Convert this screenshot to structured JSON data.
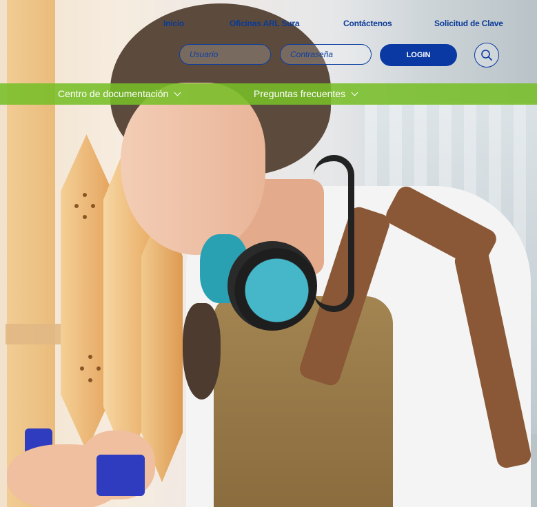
{
  "nav": {
    "items": [
      {
        "label": "Inicio"
      },
      {
        "label": "Oficinas ARL Sura"
      },
      {
        "label": "Contáctenos"
      },
      {
        "label": "Solicitud de Clave"
      }
    ]
  },
  "login": {
    "user_placeholder": "Usuario",
    "password_placeholder": "Contraseña",
    "login_label": "LOGIN",
    "search_icon": "search-icon"
  },
  "menu": {
    "items": [
      {
        "label": "Centro de documentación",
        "icon": "chevron-down-icon"
      },
      {
        "label": "Preguntas frecuentes",
        "icon": "chevron-down-icon"
      }
    ]
  },
  "colors": {
    "brand_blue": "#0a39a3",
    "menu_green": "#78be28"
  }
}
